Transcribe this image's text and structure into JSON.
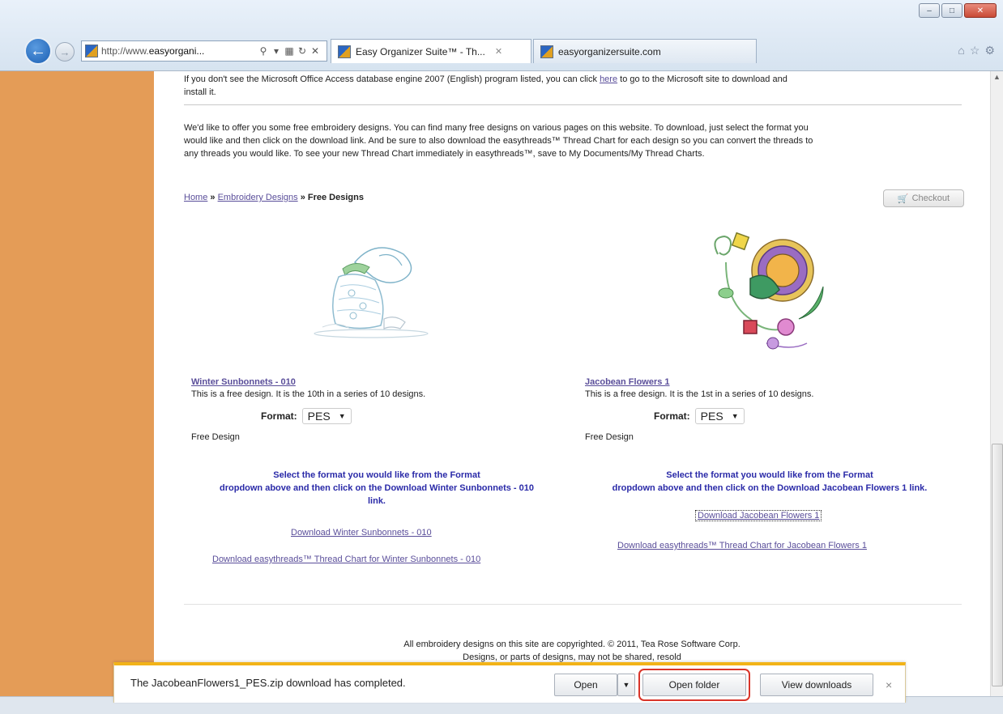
{
  "browser": {
    "url": "http://www.easyorgani...",
    "url_host_bold": "easyorgani...",
    "url_prefix": "http://www.",
    "tabs": [
      {
        "label": "Easy Organizer Suite™ - Th..."
      },
      {
        "label": "easyorganizersuite.com"
      }
    ]
  },
  "page": {
    "intro_access": "If you don't see the Microsoft Office Access database engine 2007 (English) program listed, you can click here to go to the Microsoft site to download and install it.",
    "intro_access_pre": "If you don't see the Microsoft Office Access database engine 2007 (English) program listed, you can click ",
    "intro_access_link": "here",
    "intro_access_post": " to go to the Microsoft site to download and",
    "intro_access_line2": "install it.",
    "offer_line1": "We'd like to offer you some free embroidery designs. You can find many free designs on various pages on this website. To download, just select the format you",
    "offer_line2": "would like and then click on the download link. And be sure to also download the easythreads™ Thread Chart for each design so you can convert the threads to",
    "offer_line3": "any threads you would like. To see your new Thread Chart immediately in easythreads™, save to My Documents/My Thread Charts.",
    "breadcrumb": {
      "home": "Home",
      "embroidery": "Embroidery Designs",
      "current": "Free Designs",
      "separator": "»"
    },
    "checkout_label": "Checkout",
    "designs": [
      {
        "name": "Winter Sunbonnets - 010",
        "description": "This is a free design. It is the 10th in a series of 10 designs.",
        "format_label": "Format:",
        "format_value": "PES",
        "free_label": "Free Design",
        "instruction": "Select the format you would like from the Format dropdown above and then click on the Download Winter Sunbonnets - 010 link.",
        "instruction_l1": "Select the format you would like from the Format",
        "instruction_l2": "dropdown above and then click on the Download Winter Sunbonnets - 010",
        "instruction_l3": "link.",
        "download_link": "Download Winter Sunbonnets - 010",
        "thread_link": "Download easythreads™ Thread Chart for Winter Sunbonnets - 010"
      },
      {
        "name": "Jacobean Flowers 1",
        "description": "This is a free design. It is the 1st in a series of 10 designs.",
        "format_label": "Format:",
        "format_value": "PES",
        "free_label": "Free Design",
        "instruction_l1": "Select the format you would like from the Format",
        "instruction_l2": "dropdown above and then click on the Download Jacobean Flowers 1 link.",
        "download_link": "Download Jacobean Flowers 1",
        "thread_link": "Download easythreads™ Thread Chart for Jacobean Flowers 1"
      }
    ],
    "copyright_l1": "All embroidery designs on this site are copyrighted. © 2011, Tea Rose Software Corp.",
    "copyright_l2": "Designs, or parts of designs, may not be shared, resold"
  },
  "download_bar": {
    "message": "The JacobeanFlowers1_PES.zip download has completed.",
    "open_label": "Open",
    "open_folder_label": "Open folder",
    "view_downloads_label": "View downloads",
    "close_glyph": "×"
  },
  "colors": {
    "left_bar": "#e49c57",
    "link": "#5a4e9a",
    "instruction": "#2a2aa8",
    "notification_accent": "#f2b318",
    "highlight": "#d9352a"
  }
}
